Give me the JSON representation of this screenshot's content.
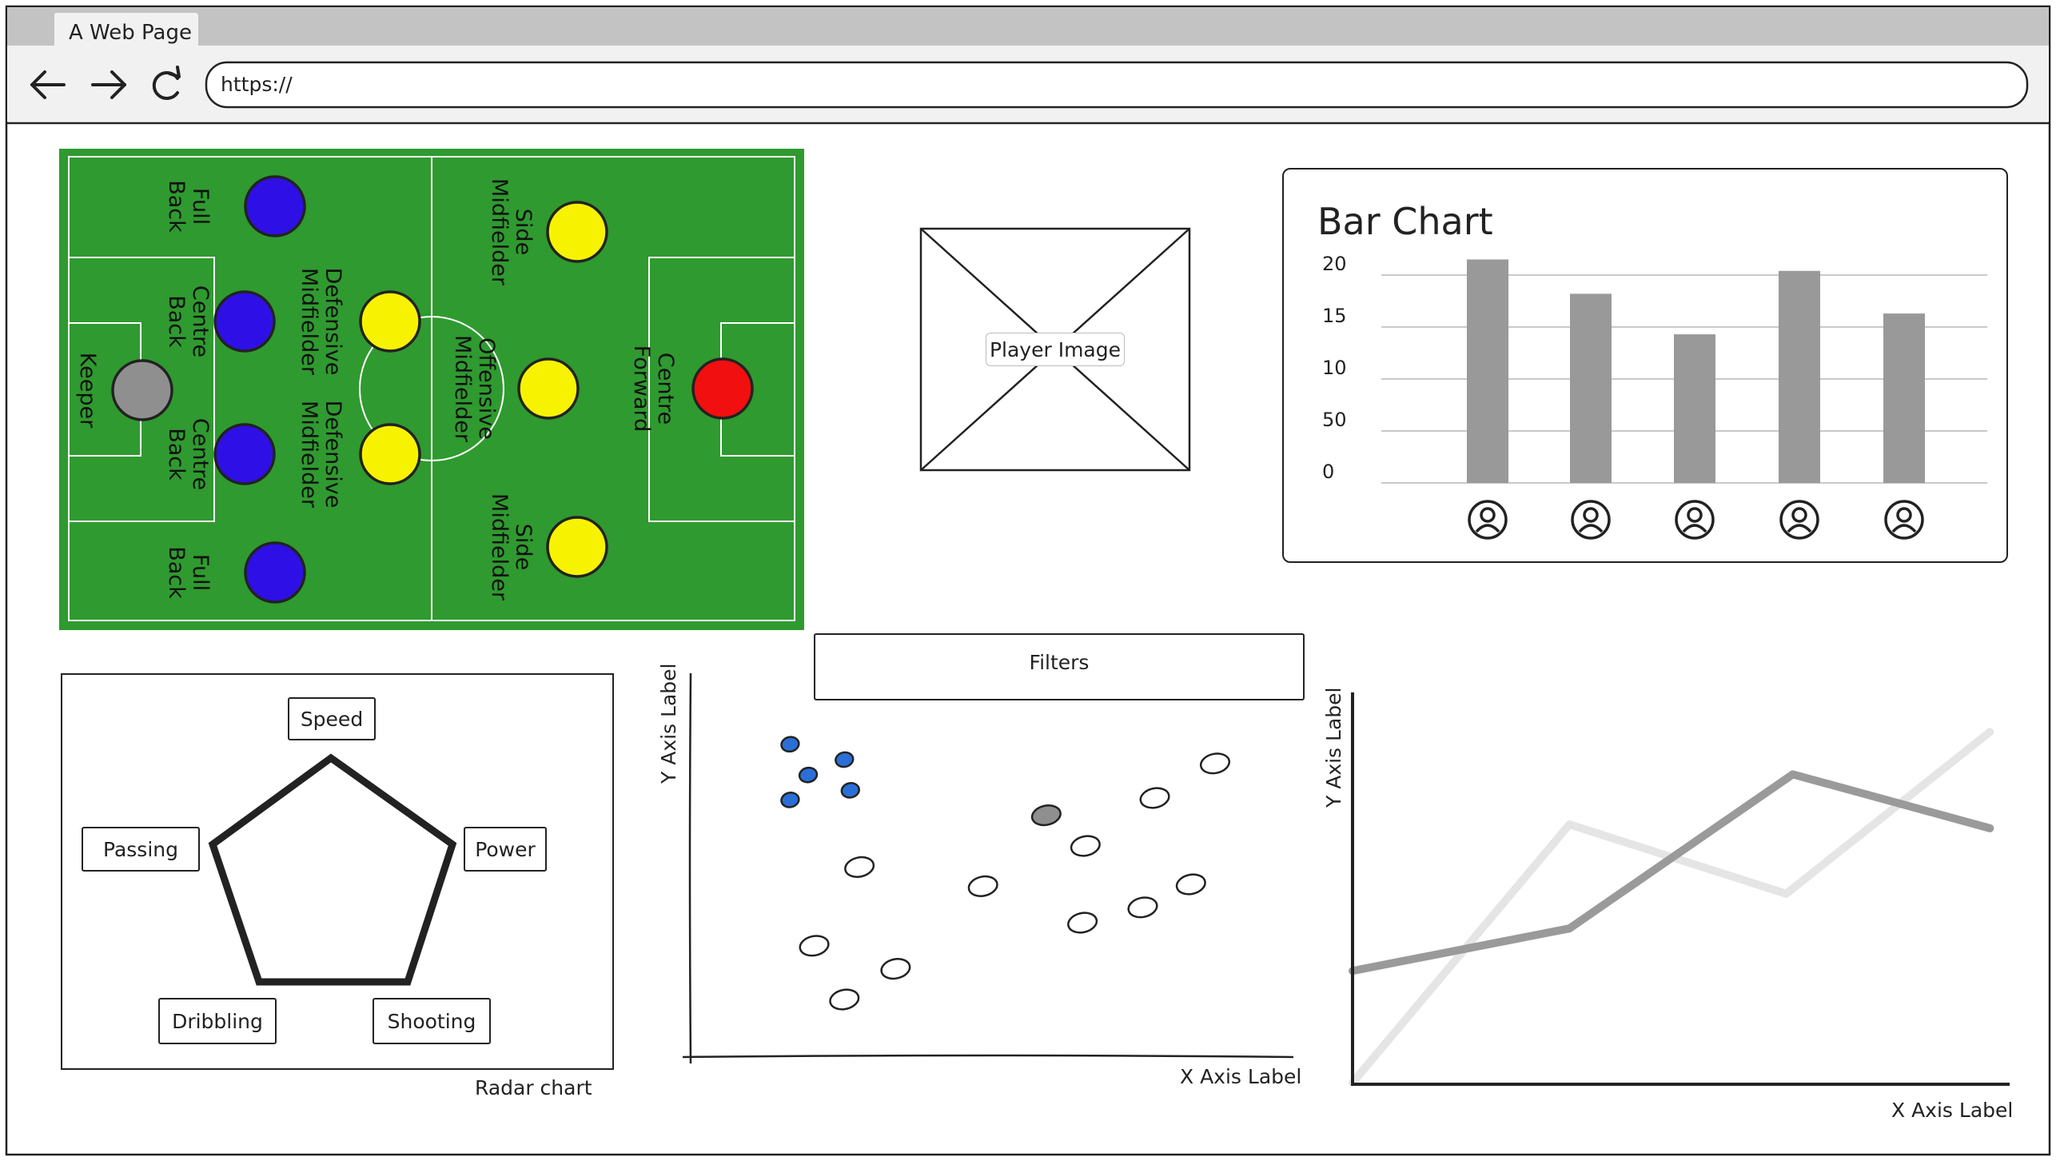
{
  "browser": {
    "tab_title": "A Web Page",
    "url": "https://"
  },
  "pitch": {
    "players": [
      {
        "label": "Keeper",
        "color": "#8f8f8f"
      },
      {
        "label": "Full Back",
        "color": "#2e10e6"
      },
      {
        "label": "Centre Back",
        "color": "#2e10e6"
      },
      {
        "label": "Centre Back",
        "color": "#2e10e6"
      },
      {
        "label": "Full Back",
        "color": "#2e10e6"
      },
      {
        "label": "Defensive Midfielder",
        "color": "#f7f300"
      },
      {
        "label": "Defensive Midfielder",
        "color": "#f7f300"
      },
      {
        "label": "Side Midfielder",
        "color": "#f7f300"
      },
      {
        "label": "Offensive Midfielder",
        "color": "#f7f300"
      },
      {
        "label": "Side Midfielder",
        "color": "#f7f300"
      },
      {
        "label": "Centre Forward",
        "color": "#f20f0f"
      }
    ],
    "grass_color": "#2f9a2f"
  },
  "player_image": {
    "label": "Player Image"
  },
  "bar_chart_panel": {
    "title": "Bar Chart"
  },
  "radar": {
    "caption": "Radar chart",
    "attributes": [
      "Speed",
      "Power",
      "Shooting",
      "Dribbling",
      "Passing"
    ]
  },
  "filters": {
    "label": "Filters"
  },
  "chart_data": [
    {
      "type": "bar",
      "title": "Bar Chart",
      "y_tick_labels": [
        "0",
        "50",
        "10",
        "15",
        "20"
      ],
      "ylim": [
        0,
        20
      ],
      "categories": [
        "user-1",
        "user-2",
        "user-3",
        "user-4",
        "user-5"
      ],
      "values": [
        21.5,
        18.2,
        14.3,
        20.4,
        16.3
      ],
      "bar_color": "#999999",
      "category_icons": "user-avatar-icon"
    },
    {
      "type": "scatter",
      "xlabel": "X Axis Label",
      "ylabel": "Y Axis Label",
      "xlim": [
        0,
        100
      ],
      "ylim": [
        0,
        100
      ],
      "points": [
        {
          "x": 16.5,
          "y": 81.5,
          "group": "blue"
        },
        {
          "x": 19.5,
          "y": 73.5,
          "group": "blue"
        },
        {
          "x": 16.5,
          "y": 67,
          "group": "blue"
        },
        {
          "x": 25.5,
          "y": 77.5,
          "group": "blue"
        },
        {
          "x": 26.5,
          "y": 69.5,
          "group": "blue"
        },
        {
          "x": 28,
          "y": 49.5,
          "group": "white"
        },
        {
          "x": 20.5,
          "y": 29,
          "group": "white"
        },
        {
          "x": 34,
          "y": 23,
          "group": "white"
        },
        {
          "x": 25.5,
          "y": 15,
          "group": "white"
        },
        {
          "x": 48.5,
          "y": 44.5,
          "group": "white"
        },
        {
          "x": 59,
          "y": 63,
          "group": "gray"
        },
        {
          "x": 65.5,
          "y": 55,
          "group": "white"
        },
        {
          "x": 65,
          "y": 35,
          "group": "white"
        },
        {
          "x": 75,
          "y": 39,
          "group": "white"
        },
        {
          "x": 83,
          "y": 45,
          "group": "white"
        },
        {
          "x": 77,
          "y": 67.5,
          "group": "white"
        },
        {
          "x": 87,
          "y": 76.5,
          "group": "white"
        }
      ],
      "colors": {
        "blue": "#2a6fd6",
        "gray": "#8f8f8f",
        "white": "#ffffff"
      }
    },
    {
      "type": "line",
      "xlabel": "X Axis Label",
      "ylabel": "Y Axis Label",
      "xlim": [
        0,
        100
      ],
      "ylim": [
        0,
        100
      ],
      "series": [
        {
          "color": "#e5e5e5",
          "points": [
            [
              0,
              0
            ],
            [
              33,
              67
            ],
            [
              66,
              49
            ],
            [
              97,
              91
            ]
          ]
        },
        {
          "color": "#9a9a9a",
          "points": [
            [
              0,
              29
            ],
            [
              33,
              40
            ],
            [
              67,
              80
            ],
            [
              97,
              66
            ]
          ]
        }
      ]
    }
  ]
}
